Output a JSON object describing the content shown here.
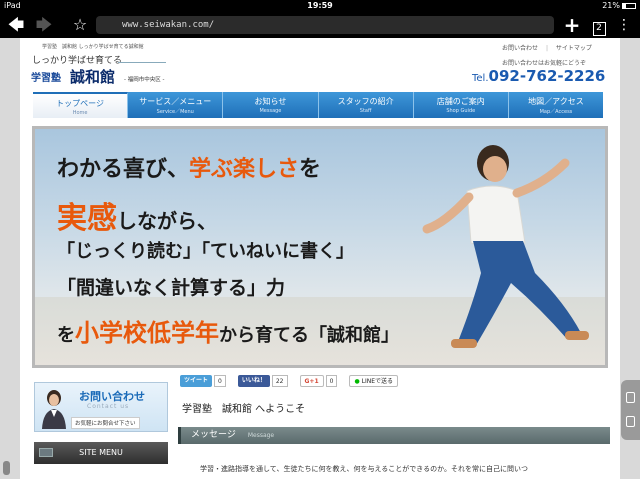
{
  "status": {
    "device": "iPad",
    "time": "19:59",
    "battery": "21%"
  },
  "browser": {
    "url": "www.seiwakan.com/",
    "tab_count": "2"
  },
  "header": {
    "small_line": "学習塾　誠和館 しっかり学ばせ育てる誠和館",
    "tagline": "しっかり学ばせ育てる",
    "logo_prefix": "学習塾",
    "logo_name": "誠和館",
    "area": "- 福岡市中央区 -",
    "links": [
      "お問い合わせ",
      "サイトマップ"
    ],
    "note": "お問い合わせはお気軽にどうぞ",
    "tel_prefix": "Tel.",
    "tel": "092-762-2226"
  },
  "nav": [
    {
      "jp": "トップページ",
      "en": "Home"
    },
    {
      "jp": "サービス／メニュー",
      "en": "Service／Menu"
    },
    {
      "jp": "お知らせ",
      "en": "Message"
    },
    {
      "jp": "スタッフの紹介",
      "en": "Staff"
    },
    {
      "jp": "店舗のご案内",
      "en": "Shop Guide"
    },
    {
      "jp": "地図／アクセス",
      "en": "Map／Access"
    }
  ],
  "hero": {
    "l1a": "わかる喜び、",
    "l1b": "学ぶ楽しさ",
    "l1c": "を",
    "l2a": "実感",
    "l2b": "しながら、",
    "l3": "「じっくり読む」「ていねいに書く」",
    "l4": "「間違いなく計算する」力",
    "l5a": "を",
    "l5b": "小学校低学年",
    "l5c": "から育てる「誠和館」"
  },
  "sidebar": {
    "contact_title": "お問い合わせ",
    "contact_en": "Contact us",
    "contact_sub": "お気軽にお問合せ下さい",
    "menu_title": "SITE MENU"
  },
  "social": {
    "tweet": "ツイート",
    "tweet_count": "0",
    "like": "いいね！",
    "like_count": "22",
    "gplus": "G+1",
    "gplus_count": "0",
    "line": "LINEで送る"
  },
  "main": {
    "welcome": "学習塾　誠和館 へようこそ",
    "message_title": "メッセージ",
    "message_en": "Message",
    "message_text": "学習・進路指導を通して、生徒たちに何を教え、何を与えることができるのか。それを常に自己に問いつ"
  }
}
